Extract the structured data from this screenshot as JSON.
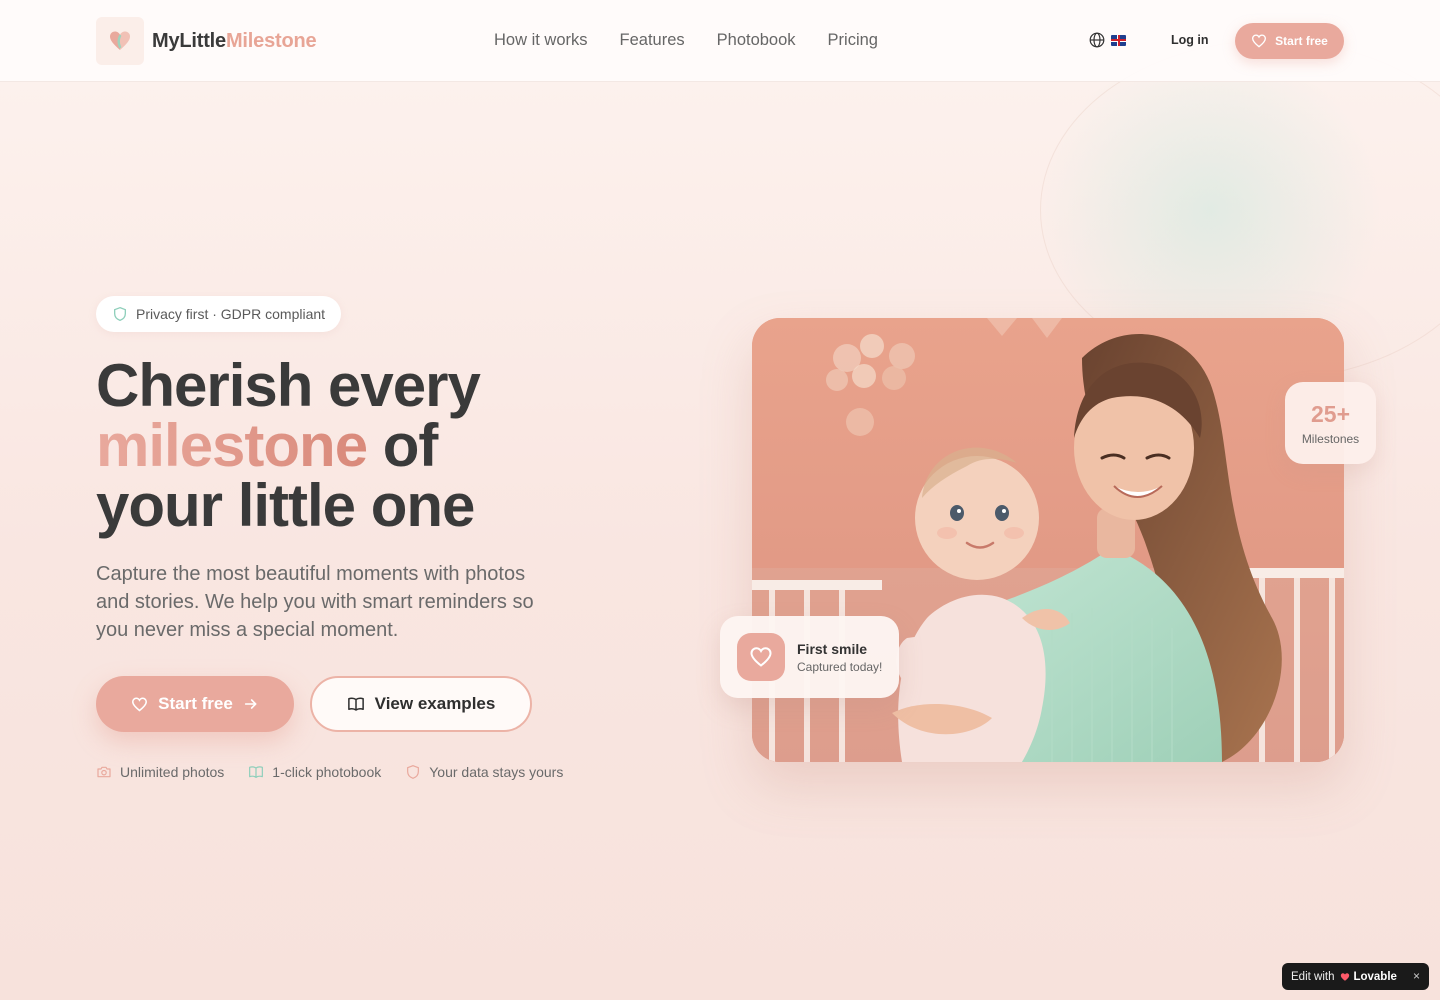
{
  "header": {
    "logo": {
      "name_part1": "MyLittle",
      "name_part2": "Milestone"
    },
    "nav": [
      "How it works",
      "Features",
      "Photobook",
      "Pricing"
    ],
    "login_label": "Log in",
    "cta_label": "Start free"
  },
  "hero": {
    "badge": "Privacy first · GDPR compliant",
    "title_line1": "Cherish every",
    "title_highlight": "milestone",
    "title_line2_rest": "of",
    "title_line3": "your little one",
    "subtitle": "Capture the most beautiful moments with photos and stories. We help you with smart reminders so you never miss a special moment.",
    "primary_cta": "Start free",
    "secondary_cta": "View examples",
    "features": [
      {
        "icon": "camera-icon",
        "label": "Unlimited photos"
      },
      {
        "icon": "book-icon",
        "label": "1-click photobook"
      },
      {
        "icon": "shield-icon",
        "label": "Your data stays yours"
      }
    ]
  },
  "visual": {
    "stat_value": "25+",
    "stat_label": "Milestones",
    "moment_title": "First smile",
    "moment_subtitle": "Captured today!"
  },
  "lovable_badge": {
    "prefix": "Edit with",
    "brand": "Lovable",
    "close": "×"
  },
  "colors": {
    "accent": "#e9a99d",
    "accent_text": "#e09c8f",
    "mint": "#bfe3d3",
    "text": "#3a3a3a"
  }
}
